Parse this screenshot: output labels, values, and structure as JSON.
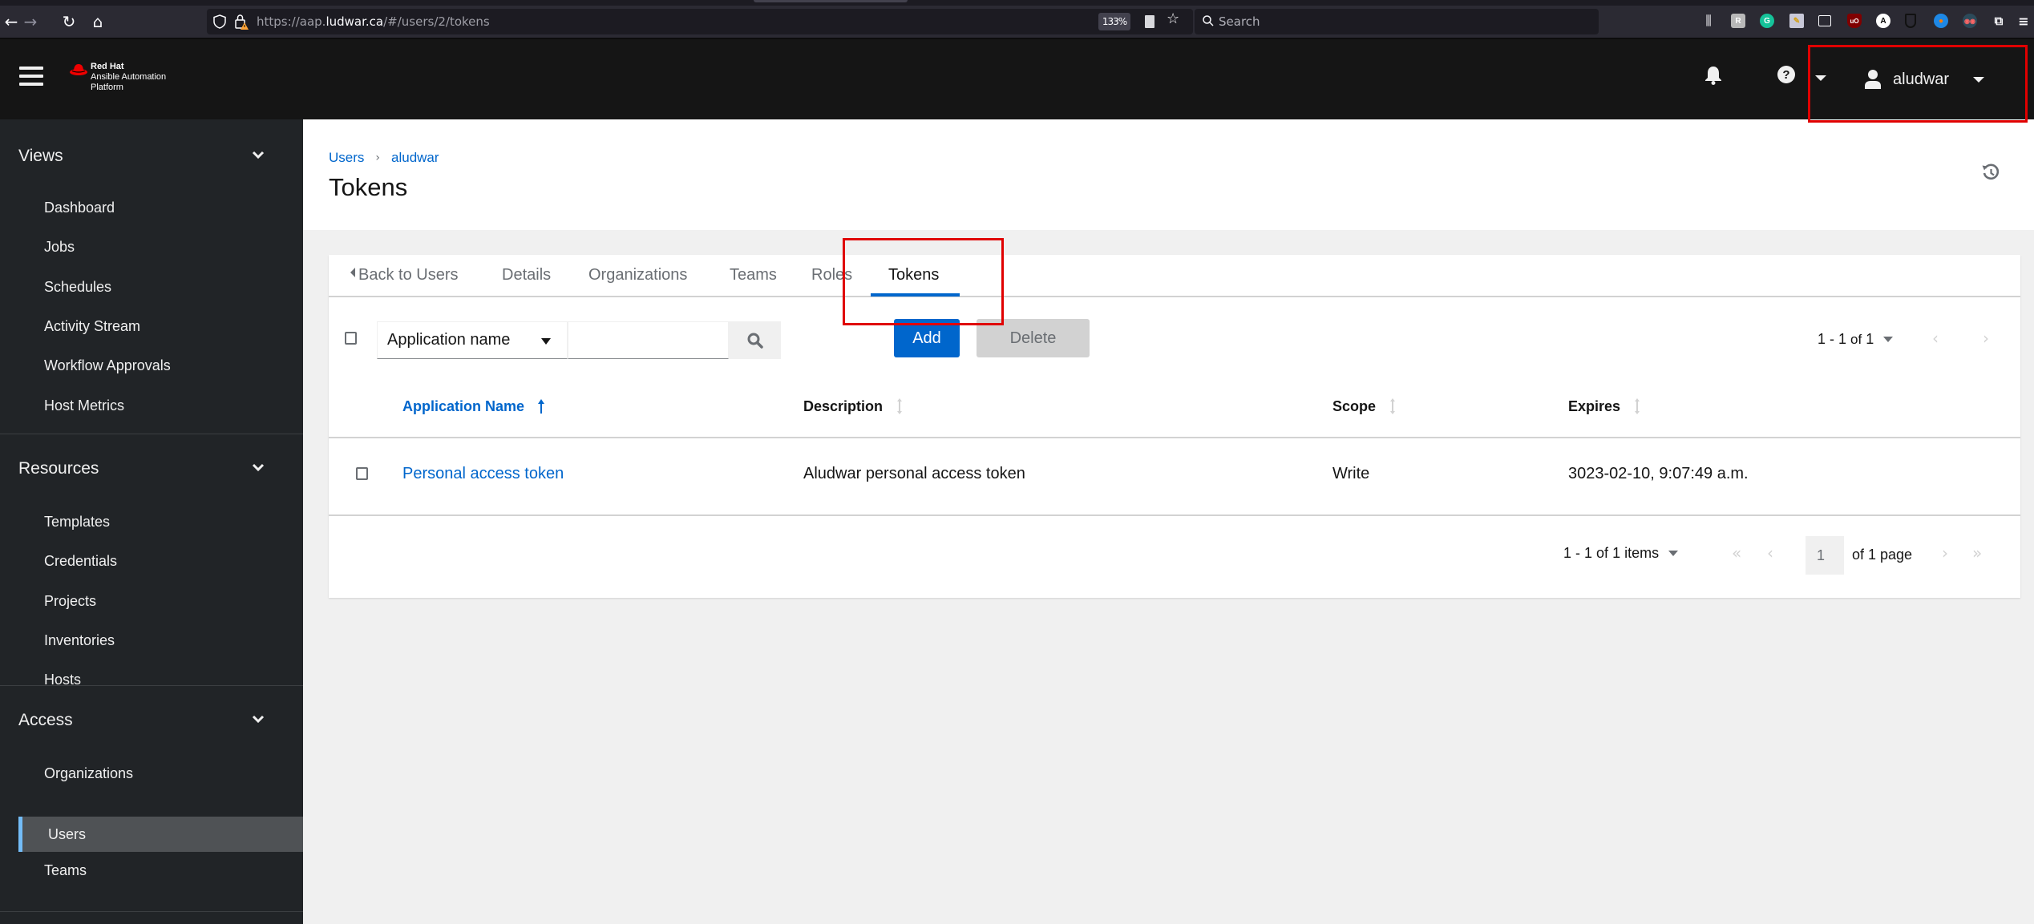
{
  "browser": {
    "url_prefix": "https://aap.",
    "url_host": "ludwar.ca",
    "url_path": "/#/users/2/tokens",
    "zoom_level": "133%",
    "search_placeholder": "Search",
    "extension_icons": [
      "library-icon",
      "extension-r-icon",
      "grammarly-icon",
      "pencil-ext-icon",
      "sidebar-icon",
      "ublock-icon",
      "a-ext-icon",
      "shield-ext-icon",
      "vpn-ext-icon",
      "spy-ext-icon",
      "extensions-icon",
      "app-menu-icon"
    ]
  },
  "masthead": {
    "brand_line1": "Red Hat",
    "brand_line2": "Ansible Automation",
    "brand_line3": "Platform",
    "username": "aludwar"
  },
  "sidebar": {
    "sections": [
      {
        "title": "Views",
        "items": [
          "Dashboard",
          "Jobs",
          "Schedules",
          "Activity Stream",
          "Workflow Approvals",
          "Host Metrics"
        ]
      },
      {
        "title": "Resources",
        "items": [
          "Templates",
          "Credentials",
          "Projects",
          "Inventories",
          "Hosts"
        ]
      },
      {
        "title": "Access",
        "items": [
          "Organizations",
          "Users",
          "Teams"
        ]
      }
    ],
    "active_item": "Users"
  },
  "header": {
    "breadcrumb": [
      "Users",
      "aludwar"
    ],
    "title": "Tokens"
  },
  "tabs": {
    "back": "Back to Users",
    "items": [
      "Details",
      "Organizations",
      "Teams",
      "Roles",
      "Tokens"
    ],
    "active": "Tokens"
  },
  "toolbar": {
    "filter_field": "Application name",
    "search_value": "",
    "add_label": "Add",
    "delete_label": "Delete",
    "pagination_range": "1 - 1",
    "pagination_of": "of",
    "pagination_total": "1"
  },
  "table": {
    "columns": [
      "Application Name",
      "Description",
      "Scope",
      "Expires"
    ],
    "sorted_column": "Application Name",
    "sort_direction": "ascending",
    "rows": [
      {
        "application_name": "Personal access token",
        "description": "Aludwar personal access token",
        "scope": "Write",
        "expires": "3023-02-10, 9:07:49 a.m."
      }
    ]
  },
  "footer_pagination": {
    "range": "1 - 1",
    "of_label": "of",
    "total": "1",
    "items_label": "items",
    "current_page": "1",
    "of_pages": "of 1 page"
  },
  "colors": {
    "accent": "#0066cc",
    "masthead_bg": "#151515",
    "sidebar_bg": "#212427",
    "sidebar_active": "#4f5255",
    "active_indicator": "#73bcf7",
    "annotation": "#e00000"
  }
}
